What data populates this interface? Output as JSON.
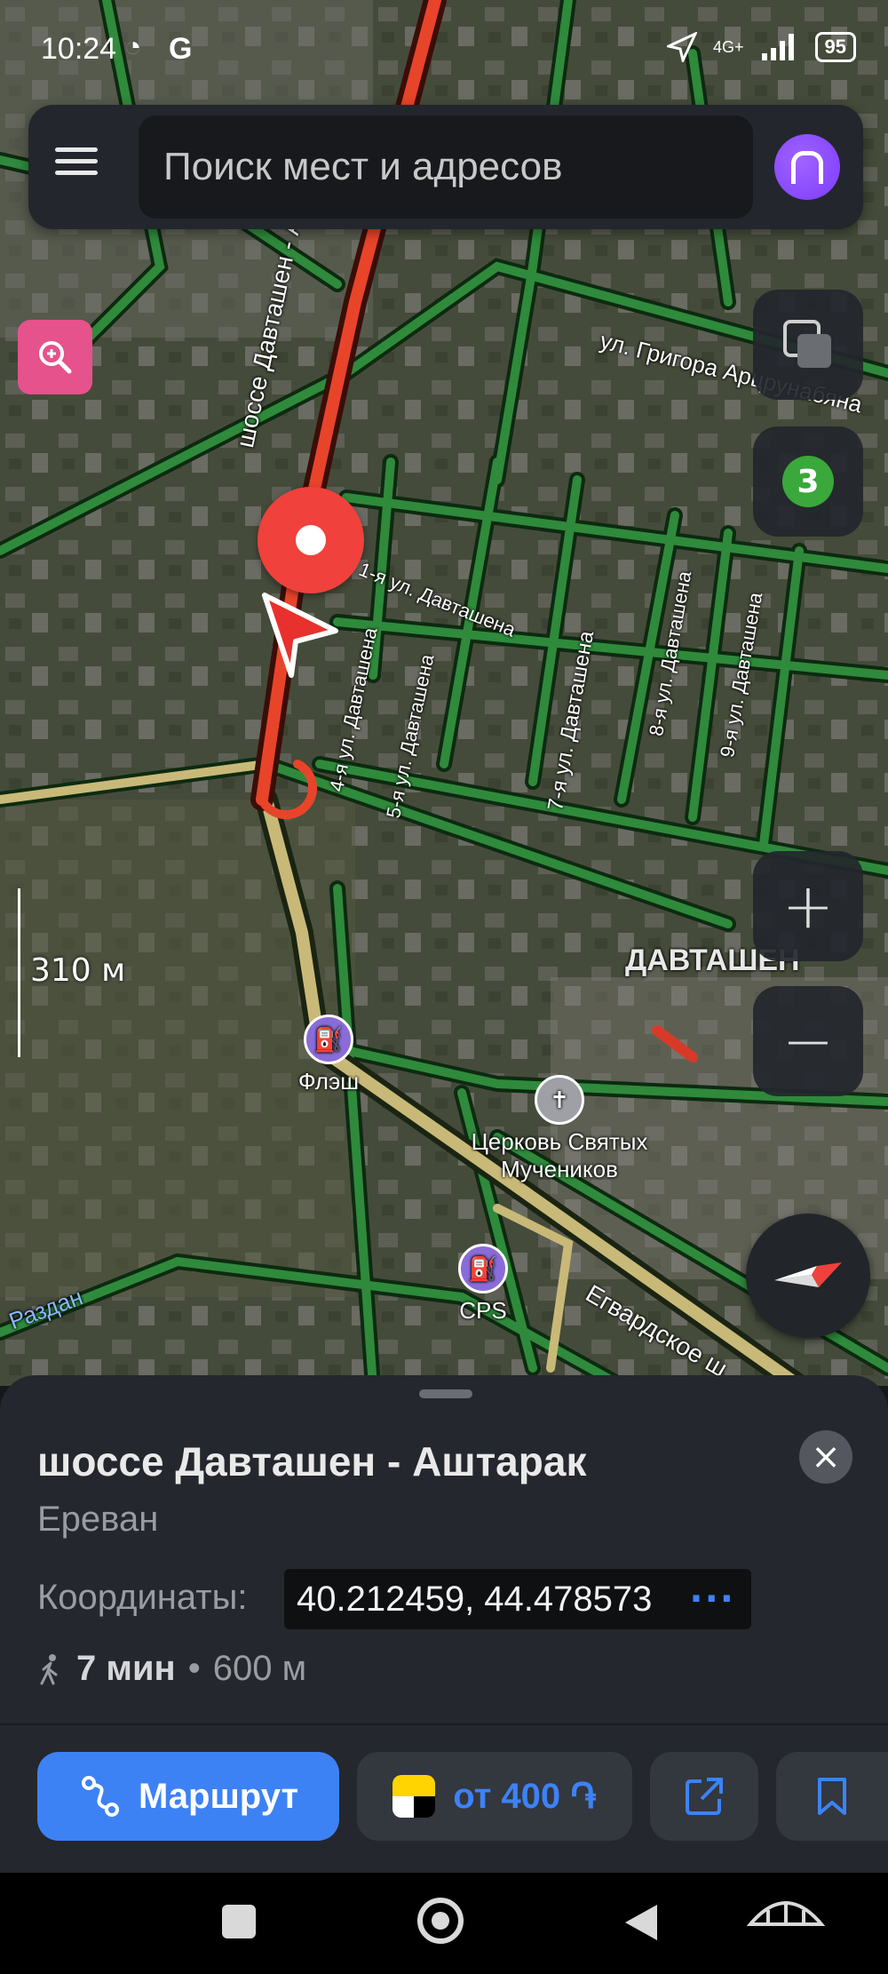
{
  "status_bar": {
    "time": "10:24",
    "google_icon_label": "G",
    "network": "4G+",
    "battery": "95"
  },
  "search": {
    "placeholder": "Поиск мест и адресов"
  },
  "map": {
    "traffic_level": "3",
    "scale": "310 м",
    "zoom_in": "+",
    "zoom_out": "−",
    "street_labels": {
      "ashtarak": "шоссе Давташен - Аштарак",
      "grigor": "ул. Григора Арцрунабяна",
      "davtashen1": "1-я ул. Давташена",
      "davtashen4": "4-я ул. Давташена",
      "davtashen5": "5-я ул. Давташена",
      "davtashen7": "7-я ул. Давташена",
      "davtashen8": "8-я ул. Давташена",
      "davtashen9": "9-я ул. Давташена",
      "egvard": "Егвардское ш.",
      "district": "ДАВТАШЕН",
      "razdan": "Раздан"
    },
    "pois": {
      "flash": "Флэш",
      "church_line1": "Церковь Святых",
      "church_line2": "Мучеников",
      "cps": "CPS"
    }
  },
  "sheet": {
    "title": "шоссе Давташен - Аштарак",
    "city": "Ереван",
    "coords_label": "Координаты:",
    "coords_value": "40.212459, 44.478573",
    "coords_more": "···",
    "walk_time": "7 мин",
    "walk_sep": "•",
    "walk_distance": "600 м",
    "route_label": "Маршрут",
    "taxi_label": "от 400 ֏"
  },
  "icons": {
    "menu": "menu-icon",
    "alice": "alice-icon",
    "zoom_search": "zoom-search-icon",
    "layers": "layers-icon",
    "compass": "compass-icon",
    "close": "close-icon",
    "walk": "walk-icon",
    "route": "route-icon",
    "taxi": "taxi-icon",
    "share": "share-icon",
    "bookmark": "bookmark-icon"
  },
  "colors": {
    "accent": "#3d82f5",
    "pin": "#f0413c",
    "traffic_green": "#2e8b3a",
    "traffic_red": "#e8442a"
  }
}
